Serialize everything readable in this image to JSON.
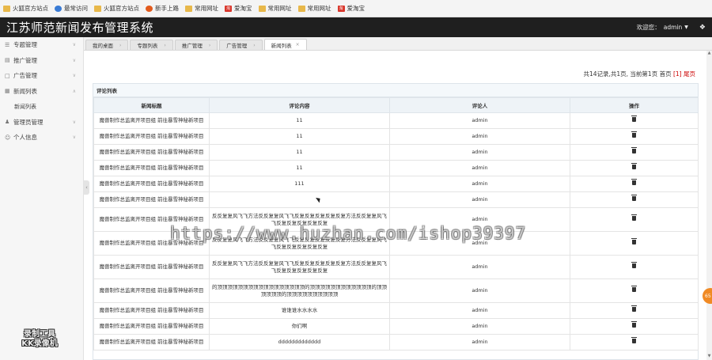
{
  "bookmarks": [
    {
      "label": "火狐官方站点",
      "icon": "folder-icon"
    },
    {
      "label": "最常访问",
      "icon": "globe-icon"
    },
    {
      "label": "火狐官方站点",
      "icon": "folder-icon"
    },
    {
      "label": "新手上路",
      "icon": "firefox-icon"
    },
    {
      "label": "常用网址",
      "icon": "folder-icon"
    },
    {
      "label": "爱淘宝",
      "icon": "taobao-icon"
    },
    {
      "label": "常用网址",
      "icon": "folder-icon"
    },
    {
      "label": "常用网址",
      "icon": "folder-icon"
    },
    {
      "label": "爱淘宝",
      "icon": "taobao-icon"
    }
  ],
  "header": {
    "title": "江苏师范新闻发布管理系统",
    "welcome": "欢迎您：",
    "username": "admin"
  },
  "sidebar": {
    "items": [
      {
        "label": "专题管理"
      },
      {
        "label": "推广管理"
      },
      {
        "label": "广告管理"
      },
      {
        "label": "新闻列表"
      },
      {
        "label": "管理员管理"
      },
      {
        "label": "个人信息"
      }
    ],
    "subitem": "新闻列表"
  },
  "tabs": [
    {
      "label": "我的桌面"
    },
    {
      "label": "专题列表"
    },
    {
      "label": "推广管理"
    },
    {
      "label": "广告管理"
    },
    {
      "label": "新闻列表"
    }
  ],
  "pager": {
    "summary": "共14记录,共1页, 当前第1页 首页",
    "current": "[1]",
    "last": "尾页"
  },
  "panel": {
    "title": "评论列表"
  },
  "table": {
    "columns": [
      "新闻标题",
      "评论内容",
      "评论人",
      "操作"
    ],
    "rows": [
      {
        "title": "魔兽制作总监离开项目组 前往暴雪神秘新项目",
        "comment": "11",
        "user": "admin",
        "tall": false
      },
      {
        "title": "魔兽制作总监离开项目组 前往暴雪神秘新项目",
        "comment": "11",
        "user": "admin",
        "tall": false
      },
      {
        "title": "魔兽制作总监离开项目组 前往暴雪神秘新项目",
        "comment": "11",
        "user": "admin",
        "tall": false
      },
      {
        "title": "魔兽制作总监离开项目组 前往暴雪神秘新项目",
        "comment": "11",
        "user": "admin",
        "tall": false
      },
      {
        "title": "魔兽制作总监离开项目组 前往暴雪神秘新项目",
        "comment": "111",
        "user": "admin",
        "tall": false
      },
      {
        "title": "魔兽制作总监离开项目组 前往暴雪神秘新项目",
        "comment": "",
        "user": "admin",
        "tall": false
      },
      {
        "title": "魔兽制作总监离开项目组 前往暴雪神秘新项目",
        "comment": "反反复复风飞飞方法反反复复风飞飞反复反复反复反复反复方法反反复复风飞飞反复反复反复反复反复",
        "user": "admin",
        "tall": true
      },
      {
        "title": "魔兽制作总监离开项目组 前往暴雪神秘新项目",
        "comment": "反反复复风飞飞方法反反复复风飞飞反复反复反复反复反复方法反反复复风飞飞反复反复反复反复反复",
        "user": "admin",
        "tall": true
      },
      {
        "title": "魔兽制作总监离开项目组 前往暴雪神秘新项目",
        "comment": "反反复复风飞飞方法反反复复风飞飞反复反复反复反复反复方法反反复复风飞飞反复反复反复反复反复",
        "user": "admin",
        "tall": true
      },
      {
        "title": "魔兽制作总监离开项目组 前往暴雪神秘新项目",
        "comment": "的顶顶顶顶顶顶顶顶顶顶顶顶顶顶顶顶顶的顶顶顶顶顶顶顶顶顶顶顶顶的顶顶顶顶顶顶的顶顶顶顶顶顶顶顶顶顶",
        "user": "admin",
        "tall": true
      },
      {
        "title": "魔兽制作总监离开项目组 前往暴雪神秘新项目",
        "comment": "谁谁谁水水水水",
        "user": "admin",
        "tall": false
      },
      {
        "title": "魔兽制作总监离开项目组 前往暴雪神秘新项目",
        "comment": "你们啊",
        "user": "admin",
        "tall": false
      },
      {
        "title": "魔兽制作总监离开项目组 前往暴雪神秘新项目",
        "comment": "ddddddddddddd",
        "user": "admin",
        "tall": false
      }
    ]
  },
  "overlay": {
    "watermark_url": "https://www.huzhan.com/ishop39397",
    "logo_line1": "录制工具",
    "logo_line2": "KK录像机",
    "float_button": "65"
  }
}
